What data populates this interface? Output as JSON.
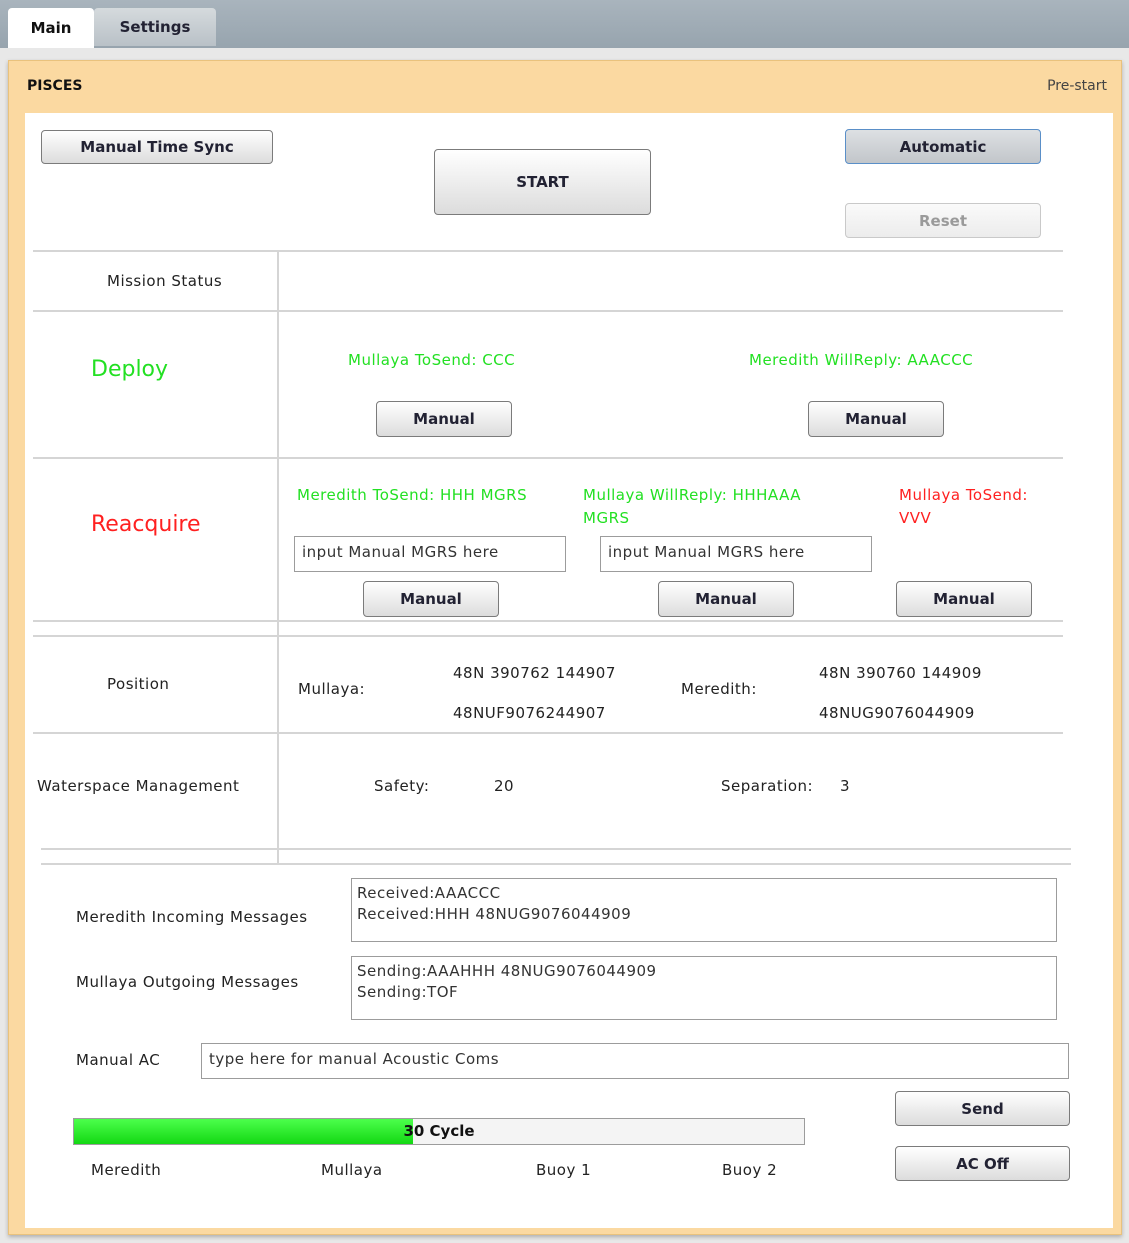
{
  "tabs": [
    {
      "label": "Main"
    },
    {
      "label": "Settings"
    }
  ],
  "panel": {
    "title": "PISCES",
    "status": "Pre-start"
  },
  "controls": {
    "time_sync": "Manual Time Sync",
    "start": "START",
    "automatic": "Automatic",
    "reset": "Reset"
  },
  "mission": {
    "label": "Mission Status"
  },
  "deploy": {
    "label": "Deploy",
    "send_text": "Mullaya ToSend: CCC",
    "reply_text": "Meredith WillReply: AAACCC",
    "manual_label": "Manual"
  },
  "reacquire": {
    "label": "Reacquire",
    "col1_text": "Meredith ToSend: HHH MGRS",
    "col2_line1": "Mullaya WillReply: HHHAAA",
    "col2_line2": "MGRS",
    "col3_line1": "Mullaya  ToSend:",
    "col3_line2": "VVV",
    "input_placeholder": "input Manual MGRS here",
    "manual_label": "Manual"
  },
  "position": {
    "label": "Position",
    "mullaya_label": "Mullaya:",
    "mullaya_utm": "48N 390762 144907",
    "mullaya_mgrs": "48NUF9076244907",
    "meredith_label": "Meredith:",
    "meredith_utm": "48N 390760 144909",
    "meredith_mgrs": "48NUG9076044909"
  },
  "waterspace": {
    "label": "Waterspace Management",
    "safety_label": "Safety:",
    "safety_value": "20",
    "separation_label": "Separation:",
    "separation_value": "3"
  },
  "messages": {
    "incoming_label": "Meredith Incoming Messages",
    "incoming": [
      "Received:AAACCC",
      "Received:HHH 48NUG9076044909"
    ],
    "outgoing_label": "Mullaya Outgoing Messages",
    "outgoing": [
      "Sending:AAAHHH 48NUG9076044909",
      "Sending:TOF"
    ]
  },
  "manual_ac": {
    "label": "Manual AC",
    "placeholder": "type here for manual Acoustic Coms",
    "send": "Send",
    "ac_off": "AC Off"
  },
  "progress": {
    "label": "30 Cycle",
    "fraction": 0.465,
    "color": "#22e022"
  },
  "nodes": [
    "Meredith",
    "Mullaya",
    "Buoy 1",
    "Buoy 2"
  ],
  "colors": {
    "green": "#22e022",
    "red": "#ff2020",
    "panel": "#fbd9a1",
    "tabbar": "#a0abb4"
  }
}
